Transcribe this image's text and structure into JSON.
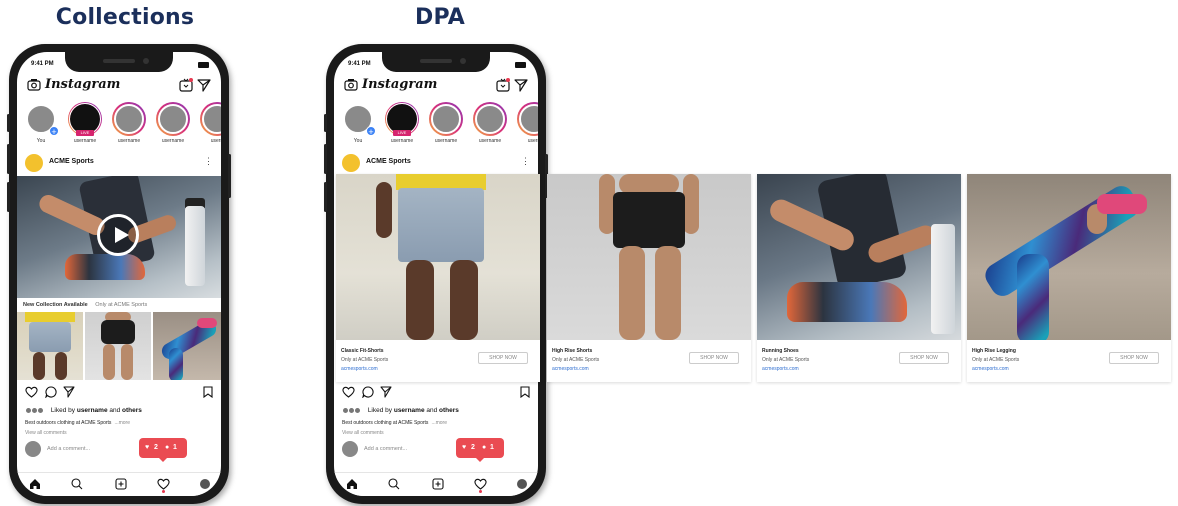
{
  "titles": {
    "collections": "Collections",
    "dpa": "DPA"
  },
  "status": {
    "time": "9:41 PM"
  },
  "ig": {
    "logo": "Instagram"
  },
  "stories": [
    {
      "label": "You",
      "type": "self"
    },
    {
      "label": "username",
      "type": "live",
      "badge": "LIVE"
    },
    {
      "label": "username",
      "type": "story"
    },
    {
      "label": "username",
      "type": "story"
    },
    {
      "label": "usern",
      "type": "story"
    }
  ],
  "post": {
    "account": "ACME Sports",
    "more": "⋮"
  },
  "collections": {
    "caption_bold": "New Collection Available",
    "caption_sub": "Only at ACME Sports"
  },
  "engagement": {
    "liked_prefix": "Liked by ",
    "liked_user": "username",
    "liked_suffix": " and ",
    "liked_others": "others",
    "caption": "Best outdoors clothing at ACME Sports",
    "more_link": "...more",
    "view_comments": "View all comments",
    "add_comment": "Add a comment..."
  },
  "notification": {
    "likes": "2",
    "comments": "1"
  },
  "dpa_products": [
    {
      "name": "Classic Fit-Shorts",
      "sub": "Only at ACME Sports",
      "link": "acmesports.com",
      "cta": "SHOP NOW"
    },
    {
      "name": "High Rise Shorts",
      "sub": "Only at ACME Sports",
      "link": "acmesports.com",
      "cta": "SHOP NOW"
    },
    {
      "name": "Running Shoes",
      "sub": "Only at ACME Sports",
      "link": "acmesports.com",
      "cta": "SHOP NOW"
    },
    {
      "name": "High Rise Legging",
      "sub": "Only at ACME Sports",
      "link": "acmesports.com",
      "cta": "SHOP NOW"
    }
  ],
  "colors": {
    "title": "#1b2f5b",
    "notification": "#ea4b52",
    "link": "#2f6fd1",
    "avatar": "#f3c12d"
  }
}
